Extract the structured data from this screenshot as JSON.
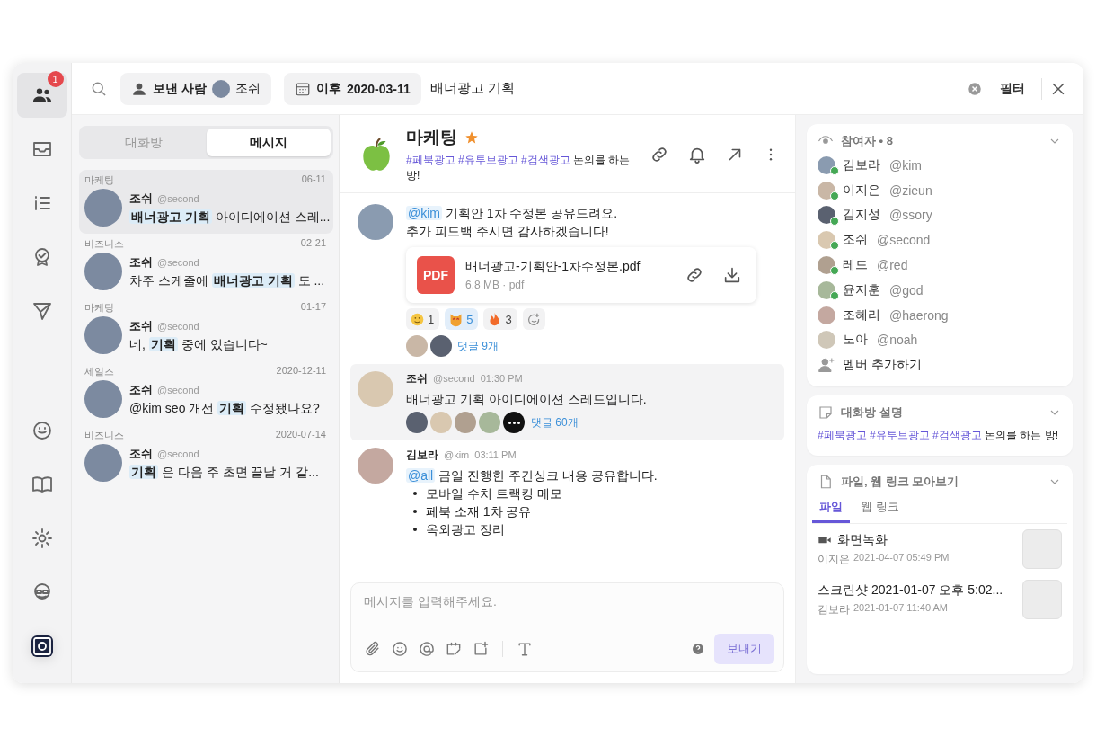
{
  "rail": {
    "top": [
      {
        "kind": "people",
        "selected": true,
        "badge": "1"
      },
      {
        "kind": "inbox",
        "selected": false
      },
      {
        "kind": "list",
        "selected": false
      },
      {
        "kind": "award",
        "selected": false
      },
      {
        "kind": "send",
        "selected": false
      }
    ],
    "bottom": [
      {
        "kind": "smiley",
        "selected": false
      },
      {
        "kind": "book",
        "selected": false
      },
      {
        "kind": "gear",
        "selected": false
      },
      {
        "kind": "avatar",
        "selected": false
      },
      {
        "kind": "app",
        "selected": false
      }
    ]
  },
  "search": {
    "chips": [
      {
        "kind": "sender",
        "label": "보낸 사람",
        "value": "조쉬"
      },
      {
        "kind": "date",
        "label": "이후",
        "value": "2020-03-11"
      }
    ],
    "query": "배너광고 기획",
    "filter": "필터"
  },
  "list_tabs": [
    {
      "label": "대화방",
      "selected": false
    },
    {
      "label": "메시지",
      "selected": true
    }
  ],
  "results": [
    {
      "room": "마케팅",
      "date": "06-11",
      "name": "조쉬",
      "handle": "@second",
      "text": "**배너광고 기획** 아이디에이션 스레...",
      "selected": true
    },
    {
      "room": "비즈니스",
      "date": "02-21",
      "name": "조쉬",
      "handle": "@second",
      "text": "차주 스케줄에 **배너광고 기획** 도 ...",
      "selected": false
    },
    {
      "room": "마케팅",
      "date": "01-17",
      "name": "조쉬",
      "handle": "@second",
      "text": "네, **기획** 중에 있습니다~",
      "selected": false
    },
    {
      "room": "세일즈",
      "date": "2020-12-11",
      "name": "조쉬",
      "handle": "@second",
      "text": "@kim seo 개선 **기획** 수정됐나요?",
      "selected": false
    },
    {
      "room": "비즈니스",
      "date": "2020-07-14",
      "name": "조쉬",
      "handle": "@second",
      "text": "**기획** 은 다음 주 초면 끝날 거 같...",
      "selected": false
    }
  ],
  "room": {
    "name": "마케팅",
    "starred": true,
    "tags": [
      "#페북광고",
      "#유투브광고",
      "#검색광고"
    ],
    "text": "논의를 하는 방!"
  },
  "messages": [
    {
      "highlighted": false,
      "mention": "@kim",
      "text": "기획안 1차 수정본 공유드려요.\n추가 피드백 주시면 감사하겠습니다!",
      "attachment": {
        "type": "PDF",
        "name": "배너광고-기획안-1차수정본.pdf",
        "meta": "6.8 MB · pdf"
      },
      "reactions": [
        {
          "kind": "smile",
          "count": "1",
          "selected": false
        },
        {
          "kind": "cat",
          "count": "5",
          "selected": true
        },
        {
          "kind": "fire",
          "count": "3",
          "selected": false
        }
      ],
      "thread": {
        "avatars": [
          {
            "kind": "photo"
          },
          {
            "kind": "photo"
          }
        ],
        "label": "댓글 9개"
      }
    },
    {
      "highlighted": true,
      "name": "조쉬",
      "handle": "@second",
      "time": "01:30 PM",
      "text": "배너광고 기획 아이디에이션 스레드입니다.",
      "thread": {
        "avatars": [
          {
            "kind": "photo"
          },
          {
            "kind": "photo"
          },
          {
            "kind": "photo"
          },
          {
            "kind": "photo"
          },
          {
            "kind": "more"
          }
        ],
        "label": "댓글 60개"
      }
    },
    {
      "highlighted": false,
      "name": "김보라",
      "handle": "@kim",
      "time": "03:11 PM",
      "mention": "@all",
      "text": "금일 진행한 주간싱크 내용 공유합니다.",
      "bullets": [
        "모바일 수치 트랙킹 메모",
        "페북 소재 1차 공유",
        "옥외광고 정리"
      ]
    }
  ],
  "composer": {
    "placeholder": "메시지를 입력해주세요.",
    "send": "보내기",
    "disabled": true
  },
  "participants": {
    "title": "참여자 • 8",
    "members": [
      {
        "name": "김보라",
        "handle": "@kim",
        "online": true
      },
      {
        "name": "이지은",
        "handle": "@zieun",
        "online": true
      },
      {
        "name": "김지성",
        "handle": "@ssory",
        "online": true
      },
      {
        "name": "조쉬",
        "handle": "@second",
        "online": true
      },
      {
        "name": "레드",
        "handle": "@red",
        "online": true
      },
      {
        "name": "윤지훈",
        "handle": "@god",
        "online": true
      },
      {
        "name": "조혜리",
        "handle": "@haerong",
        "online": false
      },
      {
        "name": "노아",
        "handle": "@noah",
        "online": false
      }
    ],
    "add": "멤버 추가하기"
  },
  "description": {
    "title": "대화방 설명",
    "tags": [
      "#페북광고",
      "#유투브광고",
      "#검색광고"
    ],
    "text": "논의를 하는 방!"
  },
  "files": {
    "title": "파일, 웹 링크 모아보기",
    "tabs": [
      {
        "label": "파일",
        "selected": true
      },
      {
        "label": "웹 링크",
        "selected": false
      }
    ],
    "items": [
      {
        "kind": "video",
        "name": "화면녹화",
        "uploader": "이지은",
        "date": "2021-04-07 05:49 PM"
      },
      {
        "kind": "image",
        "name": "스크린샷 2021-01-07 오후 5:02...",
        "uploader": "김보라",
        "date": "2021-01-07 11:40 AM"
      }
    ]
  }
}
